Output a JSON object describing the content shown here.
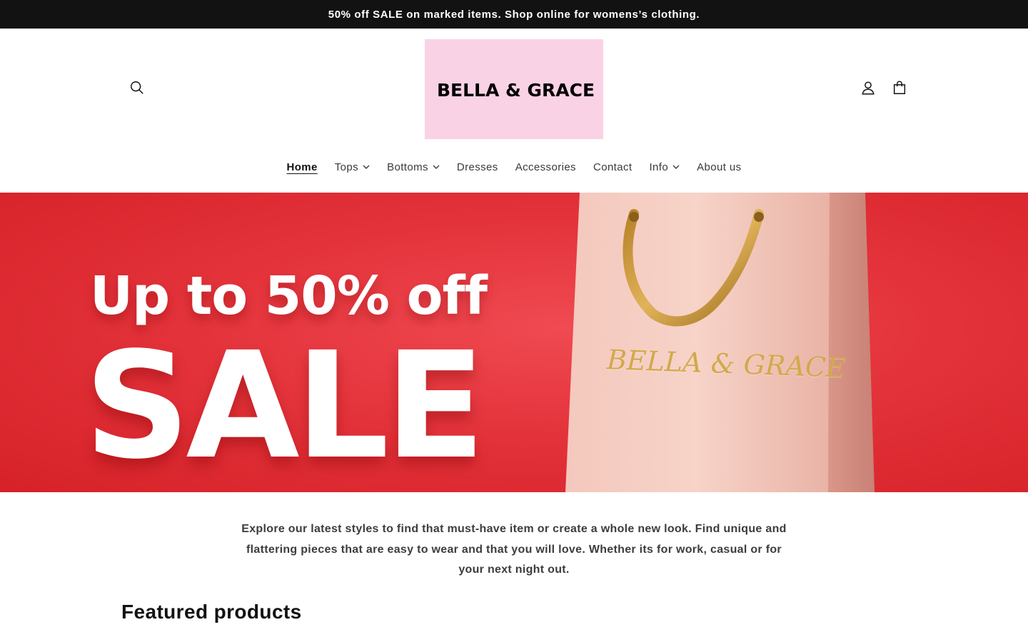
{
  "announcement": {
    "text": "50% off SALE on marked items. Shop online for womens’s clothing."
  },
  "header": {
    "logo_text": "BELLA & GRACE",
    "icons": {
      "search": "search-icon",
      "account": "user-icon",
      "cart": "shopping-bag-icon"
    },
    "logo_bg": "#f9d2e5"
  },
  "nav": {
    "items": [
      {
        "label": "Home",
        "active": true,
        "dropdown": false
      },
      {
        "label": "Tops",
        "active": false,
        "dropdown": true
      },
      {
        "label": "Bottoms",
        "active": false,
        "dropdown": true
      },
      {
        "label": "Dresses",
        "active": false,
        "dropdown": false
      },
      {
        "label": "Accessories",
        "active": false,
        "dropdown": false
      },
      {
        "label": "Contact",
        "active": false,
        "dropdown": false
      },
      {
        "label": "Info",
        "active": false,
        "dropdown": true
      },
      {
        "label": "About us",
        "active": false,
        "dropdown": false
      }
    ]
  },
  "hero": {
    "line1": "Up to 50% off",
    "line2": "SALE",
    "bag_brand": "BELLA & GRACE",
    "bg_color": "#e4333b"
  },
  "intro": {
    "text": "Explore our latest styles to find that must-have item or create a whole new look. Find unique and flattering pieces that are easy to wear and that you will love. Whether its for work, casual or for your next night out."
  },
  "featured": {
    "title": "Featured products"
  }
}
